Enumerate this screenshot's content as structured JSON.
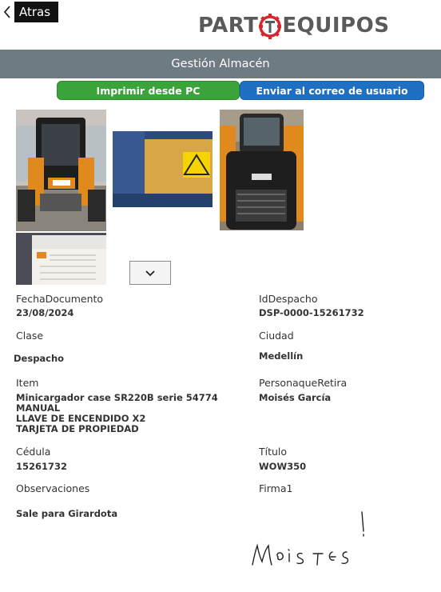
{
  "nav": {
    "back_label": "Atras"
  },
  "logo": {
    "text_left": "PART",
    "text_right": "EQUIPOS"
  },
  "header": {
    "title": "Gestión Almacén"
  },
  "actions": {
    "print_label": "Imprimir desde PC",
    "email_label": "Enviar al correo de usuario"
  },
  "colors": {
    "print_button": "#3aa33a",
    "email_button": "#1f6fc2",
    "header_bar": "#6f7b83",
    "logo_gear": "#d9262b"
  },
  "photos": [
    "skid-steer-front-photo",
    "warning-decal-photo",
    "skid-steer-rear-photo",
    "document-bag-photo"
  ],
  "dropdown": {
    "icon": "chevron-down-icon"
  },
  "fields": {
    "fecha": {
      "label": "FechaDocumento",
      "value": "23/08/2024"
    },
    "iddespacho": {
      "label": "IdDespacho",
      "value": "DSP-0000-15261732"
    },
    "clase": {
      "label": "Clase",
      "value": "Despacho"
    },
    "ciudad": {
      "label": "Ciudad",
      "value": "Medellín"
    },
    "item": {
      "label": "Item",
      "lines": [
        "Minicargador case SR220B serie 54774",
        "MANUAL",
        "LLAVE DE ENCENDIDO X2",
        "TARJETA DE PROPIEDAD"
      ]
    },
    "persona": {
      "label": "PersonaqueRetira",
      "value": "Moisés García"
    },
    "cedula": {
      "label": "Cédula",
      "value": "15261732"
    },
    "titulo": {
      "label": "Título",
      "value": "WOW350"
    },
    "observaciones": {
      "label": "Observaciones",
      "value": "Sale para Girardota"
    },
    "firma": {
      "label": "Firma1",
      "signature_text": "Moisés"
    }
  }
}
